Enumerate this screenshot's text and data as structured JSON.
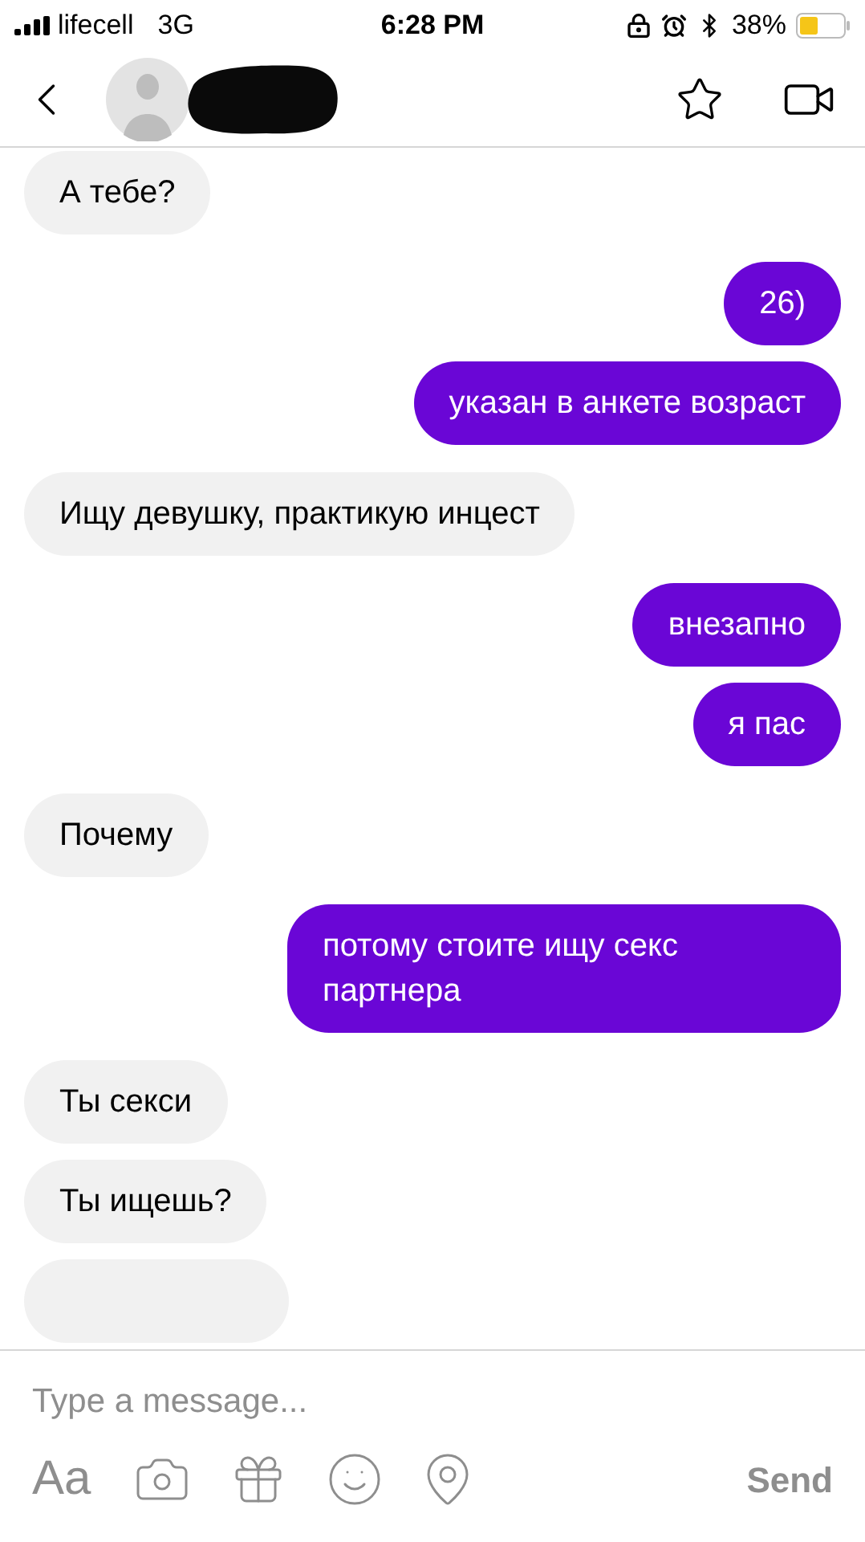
{
  "status_bar": {
    "carrier": "lifecell",
    "network": "3G",
    "time": "6:28 PM",
    "battery": "38%"
  },
  "messages": [
    {
      "kind": "incoming",
      "text": "А тебе?"
    },
    {
      "kind": "outgoing",
      "text": "26)"
    },
    {
      "kind": "outgoing",
      "text": "указан в анкете возраст"
    },
    {
      "kind": "incoming",
      "text": "Ищу девушку, практикую инцест"
    },
    {
      "kind": "outgoing",
      "text": "внезапно"
    },
    {
      "kind": "outgoing",
      "text": "я пас"
    },
    {
      "kind": "incoming",
      "text": "Почему"
    },
    {
      "kind": "outgoing",
      "text": "потому стоите ищу секс партнера"
    },
    {
      "kind": "incoming",
      "text": "Ты секси"
    },
    {
      "kind": "incoming",
      "text": "Ты ищешь?"
    },
    {
      "kind": "incoming"
    }
  ],
  "composer": {
    "placeholder": "Type a message...",
    "font_key": "Aa",
    "send": "Send"
  }
}
